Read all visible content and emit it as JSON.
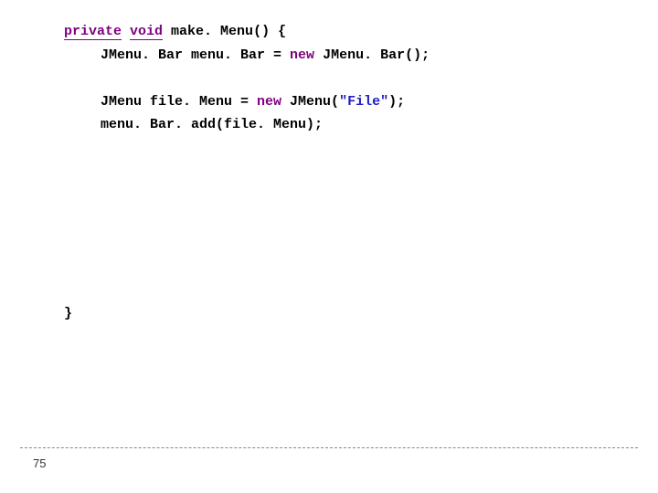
{
  "code": {
    "kw_private": "private",
    "kw_void": "void",
    "decl_rest": " make. Menu() {",
    "line2_pre": "JMenu. Bar menu. Bar = ",
    "kw_new1": "new",
    "line2_post": " JMenu. Bar();",
    "line3_pre": "JMenu file. Menu = ",
    "kw_new2": "new",
    "line3_mid": " JMenu(",
    "line3_str": "\"File\"",
    "line3_post": ");",
    "line4": "menu. Bar. add(file. Menu);",
    "close": "}"
  },
  "page_number": "75"
}
